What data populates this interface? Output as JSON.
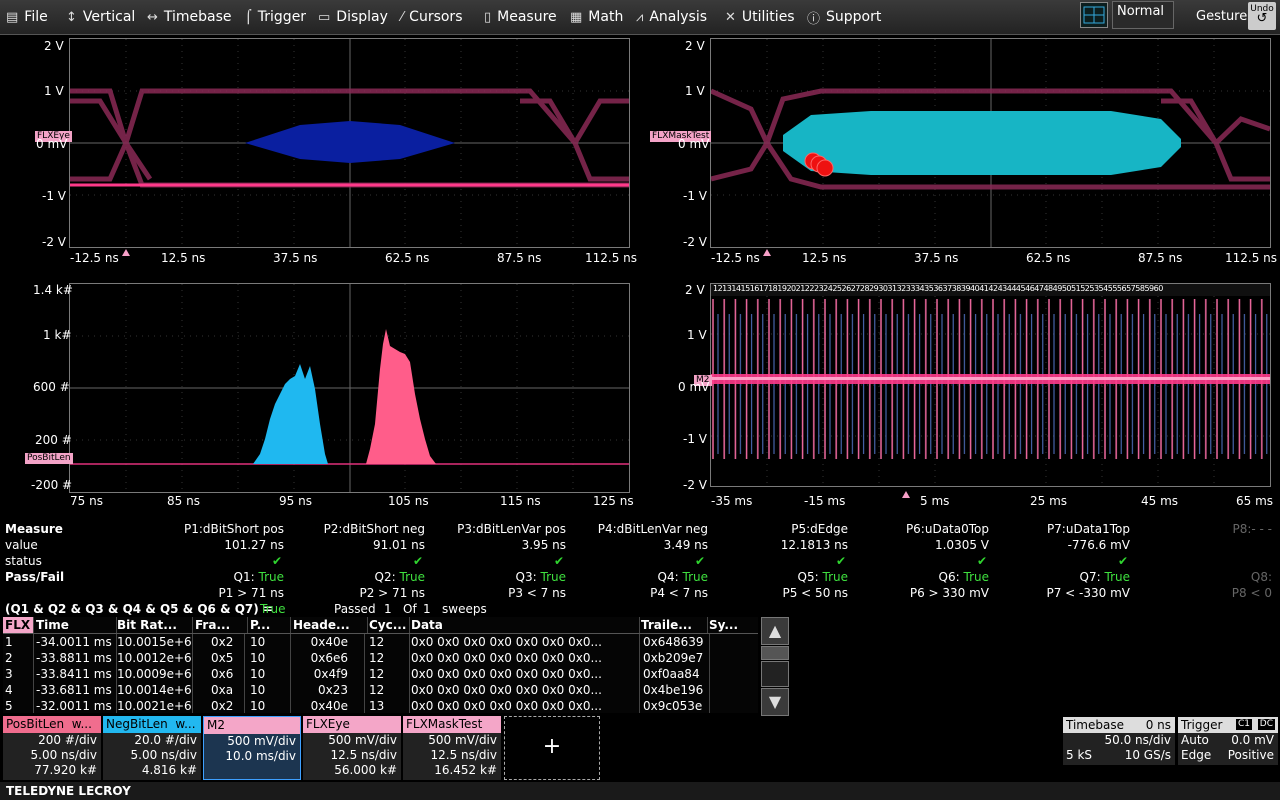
{
  "menu": {
    "items": [
      {
        "label": "File",
        "icon": "file-icon"
      },
      {
        "label": "Vertical",
        "icon": "vertical-icon"
      },
      {
        "label": "Timebase",
        "icon": "timebase-icon"
      },
      {
        "label": "Trigger",
        "icon": "trigger-icon"
      },
      {
        "label": "Display",
        "icon": "display-icon"
      },
      {
        "label": "Cursors",
        "icon": "cursors-icon"
      },
      {
        "label": "Measure",
        "icon": "measure-icon"
      },
      {
        "label": "Math",
        "icon": "math-icon"
      },
      {
        "label": "Analysis",
        "icon": "analysis-icon"
      },
      {
        "label": "Utilities",
        "icon": "utilities-icon"
      },
      {
        "label": "Support",
        "icon": "support-icon"
      }
    ],
    "trigger_mode": "Normal",
    "gesture": "Gesture",
    "undo": "Undo"
  },
  "grids": {
    "eye": {
      "tag": "FLXEye",
      "ylabels": [
        "2 V",
        "1 V",
        "0 mV",
        "-1 V",
        "-2 V"
      ],
      "xlabels": [
        "-12.5 ns",
        "12.5 ns",
        "37.5 ns",
        "62.5 ns",
        "87.5 ns",
        "112.5 ns"
      ]
    },
    "mask": {
      "tag": "FLXMaskTest",
      "ylabels": [
        "2 V",
        "1 V",
        "0 mV",
        "-1 V",
        "-2 V"
      ],
      "xlabels": [
        "-12.5 ns",
        "12.5 ns",
        "37.5 ns",
        "62.5 ns",
        "87.5 ns",
        "112.5 ns"
      ]
    },
    "hist": {
      "tag": "PosBitLen",
      "ylabels": [
        "1.4 k#",
        "1 k#",
        "600 #",
        "200 #",
        "-200 #"
      ],
      "xlabels": [
        "75 ns",
        "85 ns",
        "95 ns",
        "105 ns",
        "115 ns",
        "125 ns"
      ]
    },
    "bus": {
      "tag": "M2",
      "ylabels": [
        "2 V",
        "1 V",
        "0 mV",
        "-1 V",
        "-2 V"
      ],
      "xlabels": [
        "-35 ms",
        "-15 ms",
        "5 ms",
        "25 ms",
        "45 ms",
        "65 ms"
      ],
      "decode_text": "12131415161718192021222324252627282930313233343536373839404142434445464748495051525354555657585960"
    }
  },
  "measure": {
    "title": "Measure",
    "row_labels": {
      "value": "value",
      "status": "status",
      "passfail": "Pass/Fail"
    },
    "params": [
      {
        "name": "P1:dBitShort pos",
        "value": "101.27 ns",
        "q": "Q1:",
        "qv": "True",
        "cond": "P1 > 71 ns"
      },
      {
        "name": "P2:dBitShort neg",
        "value": "91.01 ns",
        "q": "Q2:",
        "qv": "True",
        "cond": "P2 > 71 ns"
      },
      {
        "name": "P3:dBitLenVar pos",
        "value": "3.95 ns",
        "q": "Q3:",
        "qv": "True",
        "cond": "P3 < 7 ns"
      },
      {
        "name": "P4:dBitLenVar neg",
        "value": "3.49 ns",
        "q": "Q4:",
        "qv": "True",
        "cond": "P4 < 7 ns"
      },
      {
        "name": "P5:dEdge",
        "value": "12.1813 ns",
        "q": "Q5:",
        "qv": "True",
        "cond": "P5 < 50 ns"
      },
      {
        "name": "P6:uData0Top",
        "value": "1.0305 V",
        "q": "Q6:",
        "qv": "True",
        "cond": "P6 > 330 mV"
      },
      {
        "name": "P7:uData1Top",
        "value": "-776.6 mV",
        "q": "Q7:",
        "qv": "True",
        "cond": "P7 < -330 mV"
      },
      {
        "name": "P8:- - -",
        "value": "",
        "q": "Q8:",
        "qv": "",
        "cond": "P8 < 0"
      }
    ],
    "summary": {
      "expr": "(Q1 & Q2 & Q3 & Q4 & Q5 & Q6 & Q7) =",
      "result": "True",
      "passed_label": "Passed",
      "passed": "1",
      "of_label": "Of",
      "total": "1",
      "sweeps": "sweeps"
    }
  },
  "table": {
    "headers": [
      "FLX",
      "Time",
      "Bit Rat...",
      "Fra...",
      "P...",
      "Heade...",
      "Cyc...",
      "Data",
      "Traile...",
      "Sy..."
    ],
    "rows": [
      [
        "1",
        "-34.0011 ms",
        "10.0015e+6",
        "0x2",
        "10",
        "0x40e",
        "12",
        "0x0 0x0 0x0 0x0 0x0 0x0 0x0...",
        "0x648639",
        ""
      ],
      [
        "2",
        "-33.8811 ms",
        "10.0012e+6",
        "0x5",
        "10",
        "0x6e6",
        "12",
        "0x0 0x0 0x0 0x0 0x0 0x0 0x0...",
        "0xb209e7",
        ""
      ],
      [
        "3",
        "-33.8411 ms",
        "10.0009e+6",
        "0x6",
        "10",
        "0x4f9",
        "12",
        "0x0 0x0 0x0 0x0 0x0 0x0 0x0...",
        "0xf0aa84",
        ""
      ],
      [
        "4",
        "-33.6811 ms",
        "10.0014e+6",
        "0xa",
        "10",
        "0x23",
        "12",
        "0x0 0x0 0x0 0x0 0x0 0x0 0x0...",
        "0x4be196",
        ""
      ],
      [
        "5",
        "-32.0011 ms",
        "10.0021e+6",
        "0x2",
        "10",
        "0x40e",
        "13",
        "0x0 0x0 0x0 0x0 0x0 0x0 0x0...",
        "0x9c053e",
        ""
      ]
    ]
  },
  "descriptors": [
    {
      "name": "PosBitLen",
      "suffix": "w...",
      "l1": "200 #/div",
      "l2": "5.00 ns/div",
      "l3": "77.920 k#",
      "color": "#f06d8e"
    },
    {
      "name": "NegBitLen",
      "suffix": "w...",
      "l1": "20.0 #/div",
      "l2": "5.00 ns/div",
      "l3": "4.816 k#",
      "color": "#22b8f0"
    },
    {
      "name": "M2",
      "suffix": "",
      "l1": "500 mV/div",
      "l2": "10.0 ms/div",
      "l3": "",
      "color": "#f4a6c8"
    },
    {
      "name": "FLXEye",
      "suffix": "",
      "l1": "500 mV/div",
      "l2": "12.5 ns/div",
      "l3": "56.000 k#",
      "color": "#f4a6c8"
    },
    {
      "name": "FLXMaskTest",
      "suffix": "",
      "l1": "500 mV/div",
      "l2": "12.5 ns/div",
      "l3": "16.452 k#",
      "color": "#f4a6c8"
    }
  ],
  "add": "+",
  "timebase": {
    "label": "Timebase",
    "delay": "0 ns",
    "div": "50.0 ns/div",
    "samples": "5 kS",
    "rate": "10 GS/s"
  },
  "trigger": {
    "label": "Trigger",
    "coupling1": "C1",
    "coupling2": "DC",
    "mode": "Auto",
    "level": "0.0 mV",
    "type": "Edge",
    "slope": "Positive"
  },
  "footer": "TELEDYNE LECROY",
  "colors": {
    "accent_pink": "#f4a6c8",
    "trace_magenta": "#e0307a",
    "hist_pos": "#ff5d8a",
    "hist_neg": "#1fb8f0",
    "mask_cyan": "#17b5c5",
    "eye_blue": "#0a1fa0",
    "pass_green": "#3fe03f"
  }
}
